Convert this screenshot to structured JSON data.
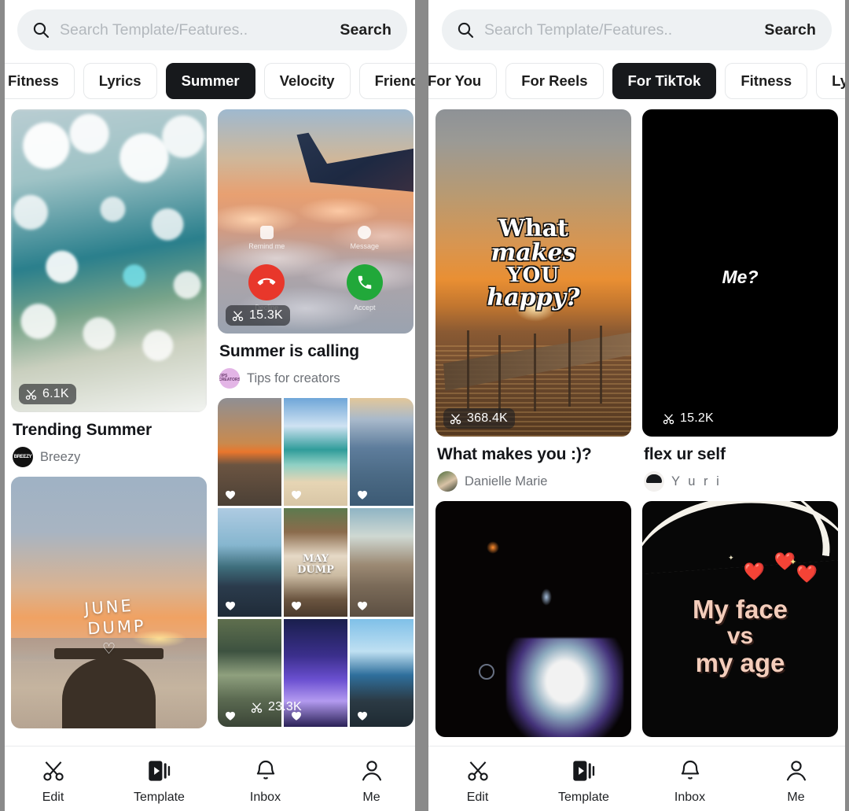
{
  "app": {
    "accent_dark": "#17191c",
    "chip_border": "#e6e8ea",
    "search_bg": "#eef1f3",
    "badge_bg": "rgba(30,32,36,0.62)"
  },
  "left_panel": {
    "search": {
      "placeholder": "Search Template/Features..",
      "value": "",
      "button_label": "Search",
      "icon": "search-icon"
    },
    "chips": [
      {
        "label": "Fitness",
        "active": false
      },
      {
        "label": "Lyrics",
        "active": false
      },
      {
        "label": "Summer",
        "active": true
      },
      {
        "label": "Velocity",
        "active": false
      },
      {
        "label": "Friends",
        "active": false
      }
    ],
    "cards": [
      {
        "title": "Trending Summer",
        "author": "Breezy",
        "uses": "6.1K",
        "uses_icon": "scissors-icon",
        "art": "bokeh"
      },
      {
        "title": "",
        "author": "",
        "uses": "",
        "art": "june-dump",
        "overlay_line1": "JUNE",
        "overlay_line2": "DUMP",
        "overlay_heart": "♡"
      },
      {
        "title": "Summer is calling",
        "author": "Tips for creators",
        "uses": "15.3K",
        "uses_icon": "scissors-icon",
        "art": "airplane-call",
        "call_ui": {
          "remind_label": "Remind me",
          "message_label": "Message",
          "decline_label": "Decline",
          "accept_label": "Accept"
        }
      },
      {
        "title": "",
        "author": "",
        "uses": "23.3K",
        "uses_icon": "scissors-icon",
        "art": "collage-3x3",
        "collage_text_line1": "MAY",
        "collage_text_line2": "DUMP"
      }
    ]
  },
  "right_panel": {
    "search": {
      "placeholder": "Search Template/Features..",
      "value": "",
      "button_label": "Search",
      "icon": "search-icon"
    },
    "chips": [
      {
        "label": "For You",
        "active": false
      },
      {
        "label": "For Reels",
        "active": false
      },
      {
        "label": "For TikTok",
        "active": true
      },
      {
        "label": "Fitness",
        "active": false
      },
      {
        "label": "Lyrics",
        "active": false
      }
    ],
    "cards": [
      {
        "title": "What makes you :)?",
        "author": "Danielle Marie",
        "uses": "368.4K",
        "uses_icon": "scissors-icon",
        "art": "sunset-pier",
        "overlay": [
          "What",
          "makes",
          "YOU",
          "happy?"
        ]
      },
      {
        "title": "flex ur self",
        "author": "Y u r i",
        "uses": "15.2K",
        "uses_icon": "scissors-icon",
        "art": "black-me",
        "overlay_text": "Me?"
      },
      {
        "title": "",
        "author": "",
        "uses": "",
        "art": "dark-glow"
      },
      {
        "title": "",
        "author": "",
        "uses": "",
        "art": "my-face",
        "overlay": [
          "My face",
          "vs",
          "my age"
        ]
      }
    ]
  },
  "bottom_nav": {
    "items": [
      {
        "label": "Edit",
        "icon": "scissors-icon",
        "active": false
      },
      {
        "label": "Template",
        "icon": "template-play-icon",
        "active": true
      },
      {
        "label": "Inbox",
        "icon": "bell-icon",
        "active": false
      },
      {
        "label": "Me",
        "icon": "person-icon",
        "active": false
      }
    ]
  }
}
